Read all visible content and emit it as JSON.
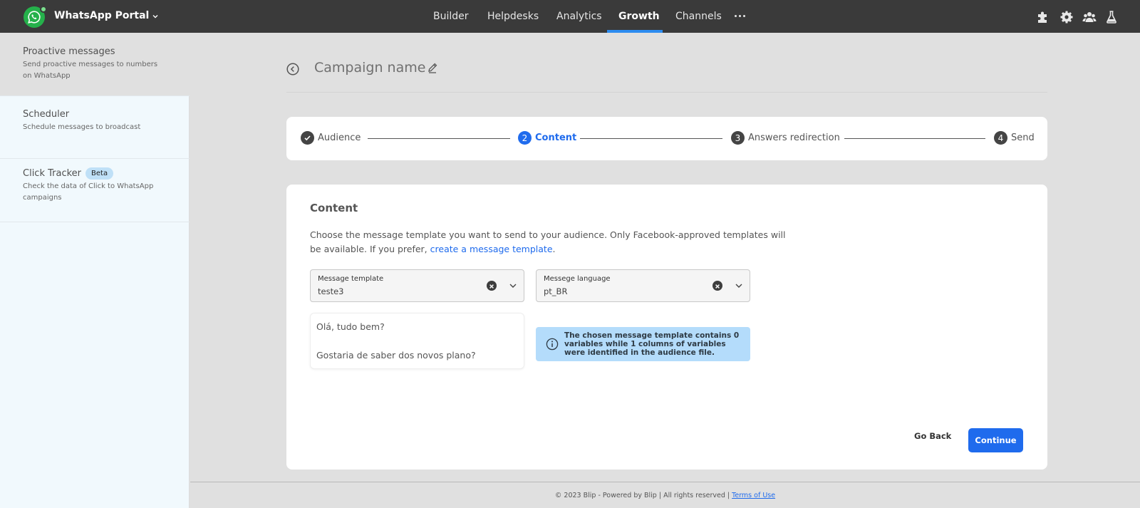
{
  "header": {
    "app_name": "WhatsApp Portal",
    "nav": [
      "Builder",
      "Helpdesks",
      "Analytics",
      "Growth",
      "Channels"
    ],
    "active_nav": "Growth"
  },
  "sidebar": {
    "items": [
      {
        "title": "Proactive messages",
        "desc": "Send proactive messages to numbers on WhatsApp"
      },
      {
        "title": "Scheduler",
        "desc": "Schedule messages to broadcast"
      },
      {
        "title": "Click Tracker",
        "badge": "Beta",
        "desc": "Check the data of Click to WhatsApp campaigns"
      }
    ]
  },
  "campaign": {
    "title": "Campaign name"
  },
  "stepper": {
    "steps": [
      {
        "number": "",
        "label": "Audience",
        "state": "done"
      },
      {
        "number": "2",
        "label": "Content",
        "state": "active"
      },
      {
        "number": "3",
        "label": "Answers redirection",
        "state": "pending"
      },
      {
        "number": "4",
        "label": "Send",
        "state": "pending"
      }
    ]
  },
  "content": {
    "title": "Content",
    "description": "Choose the message template you want to send to your audience. Only Facebook-approved templates will be available. If you prefer,",
    "link_text": "create a message template",
    "after_link": ".",
    "template_field": {
      "label": "Message template",
      "value": "teste3"
    },
    "language_field": {
      "label": "Messege language",
      "value": "pt_BR"
    },
    "preview_lines": [
      "Olá, tudo bem?",
      "Gostaria de saber dos novos plano?"
    ],
    "info_message": "The chosen message template contains 0 variables while 1 columns of variables were identified in the audience file.",
    "go_back": "Go Back",
    "continue": "Continue"
  },
  "footer": {
    "text": "© 2023 Blip - Powered by Blip | All rights reserved |",
    "link": "Terms of Use"
  },
  "colors": {
    "topbar": "#3a3a3a",
    "accent": "#1f6bed",
    "whatsapp_green": "#25b14b",
    "info_bg": "#b4dcfb",
    "sidebar_bg": "#f1f9fd"
  },
  "icons": [
    "whatsapp-icon",
    "chevron-down-icon",
    "more-dots-icon",
    "puzzle-icon",
    "gear-icon",
    "team-icon",
    "flask-icon",
    "back-arrow-icon",
    "pencil-icon",
    "check-icon",
    "clear-icon",
    "info-icon"
  ]
}
